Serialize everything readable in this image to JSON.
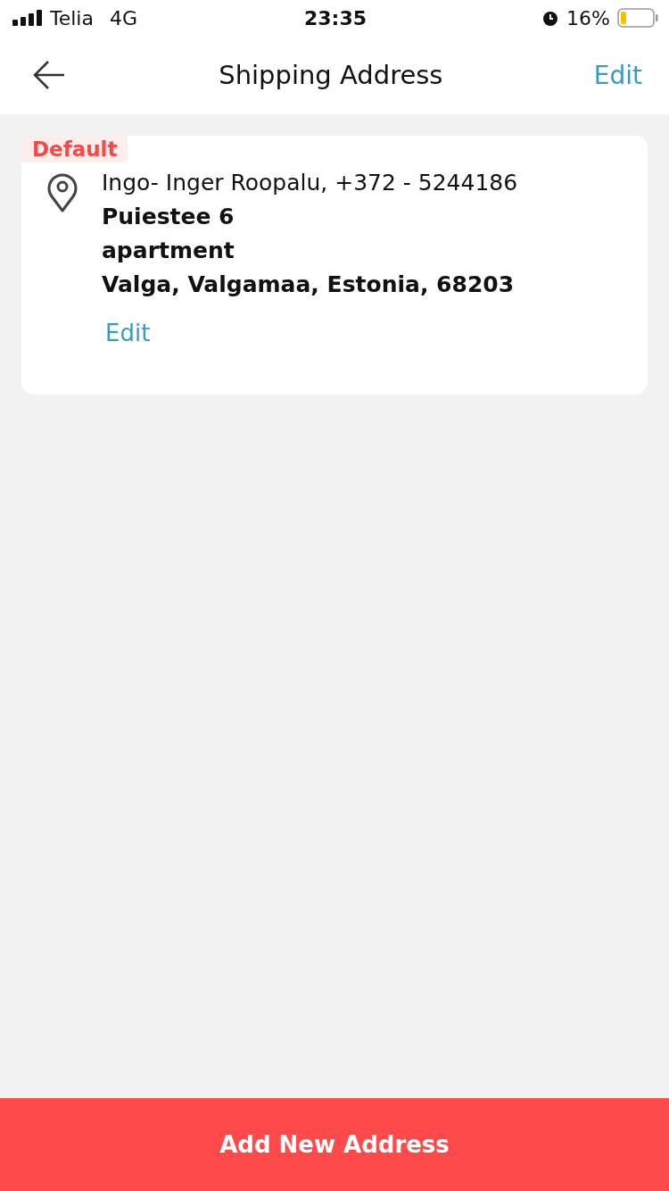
{
  "status_bar": {
    "carrier": "Telia",
    "network": "4G",
    "time": "23:35",
    "battery": "16%"
  },
  "nav_bar": {
    "title": "Shipping Address",
    "action": "Edit"
  },
  "addresses": [
    {
      "badge": "Default",
      "contact": "Ingo- Inger Roopalu, +372 - 5244186",
      "lines": [
        "Puiestee 6",
        "apartment",
        "Valga, Valgamaa, Estonia, 68203"
      ],
      "action": "Edit"
    }
  ],
  "footer_button": "Add New Address"
}
